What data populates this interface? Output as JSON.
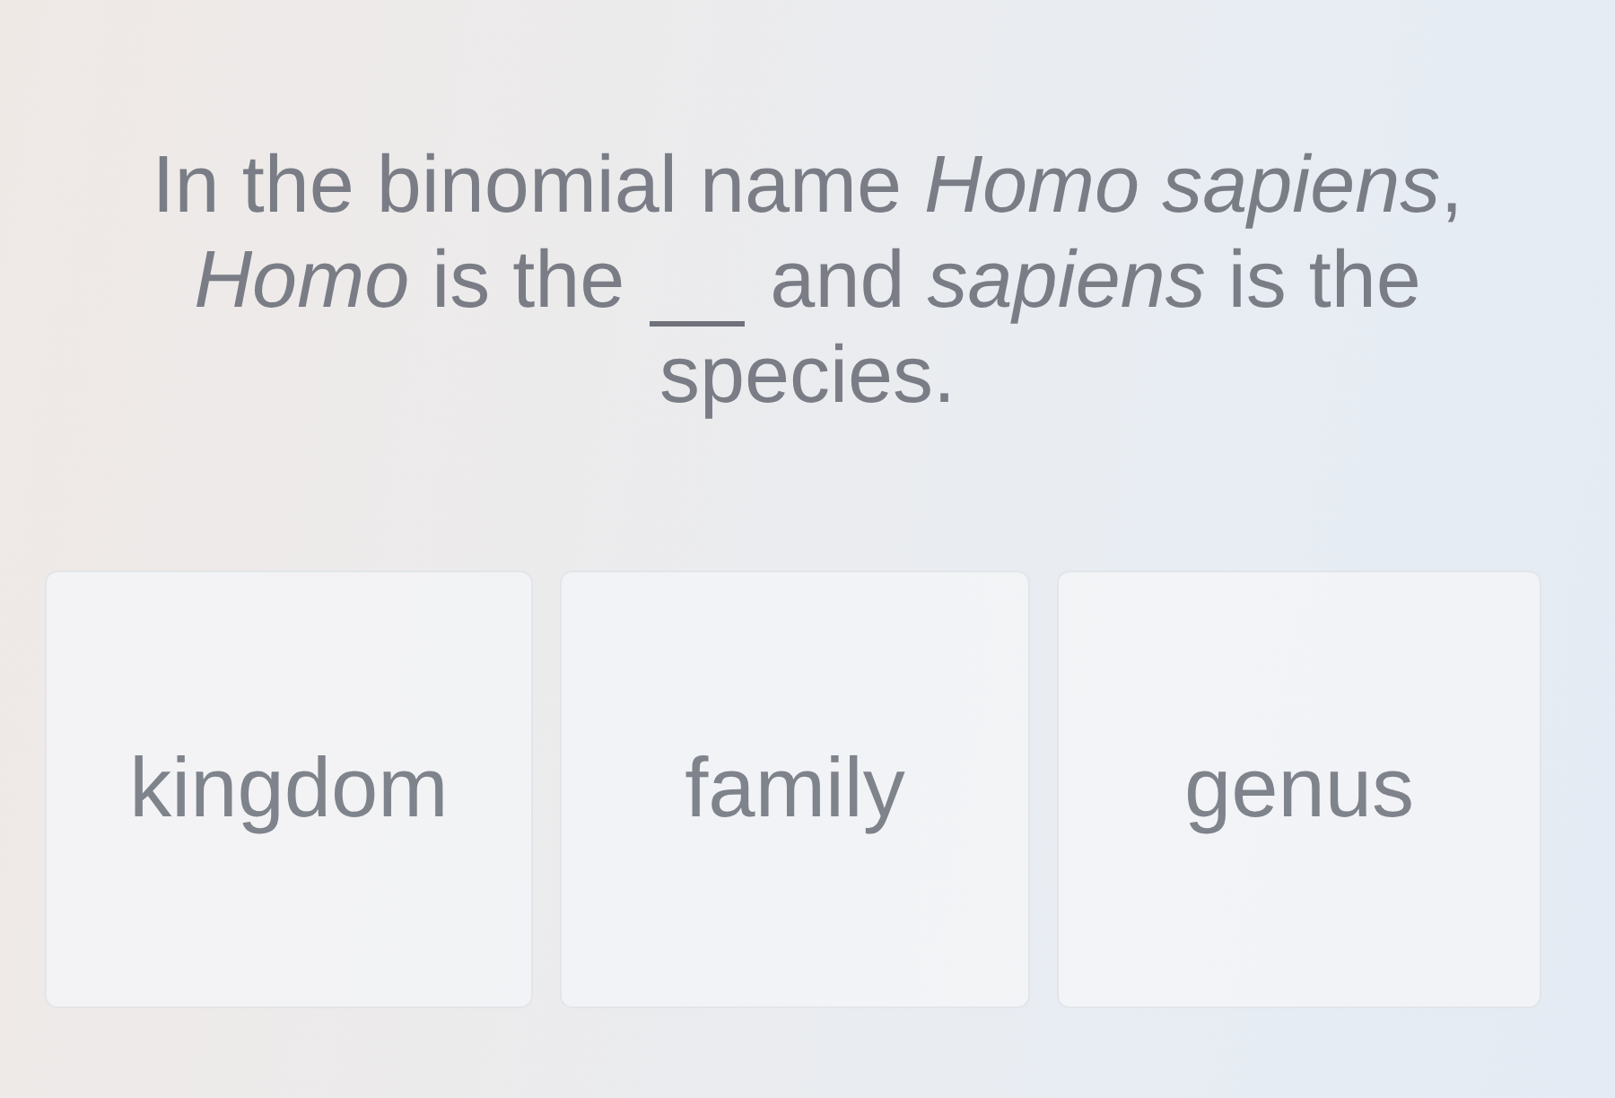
{
  "question": [
    [
      {
        "kind": "text",
        "text": "In the binomial name *Homo sapiens*,"
      }
    ],
    [
      {
        "kind": "text",
        "text": "*Homo* is the"
      },
      {
        "kind": "blank"
      },
      {
        "kind": "text",
        "text": "and *sapiens* is the"
      }
    ],
    [
      {
        "kind": "text",
        "text": "species."
      }
    ]
  ],
  "options": [
    {
      "label": "kingdom"
    },
    {
      "label": "family"
    },
    {
      "label": "genus"
    }
  ]
}
